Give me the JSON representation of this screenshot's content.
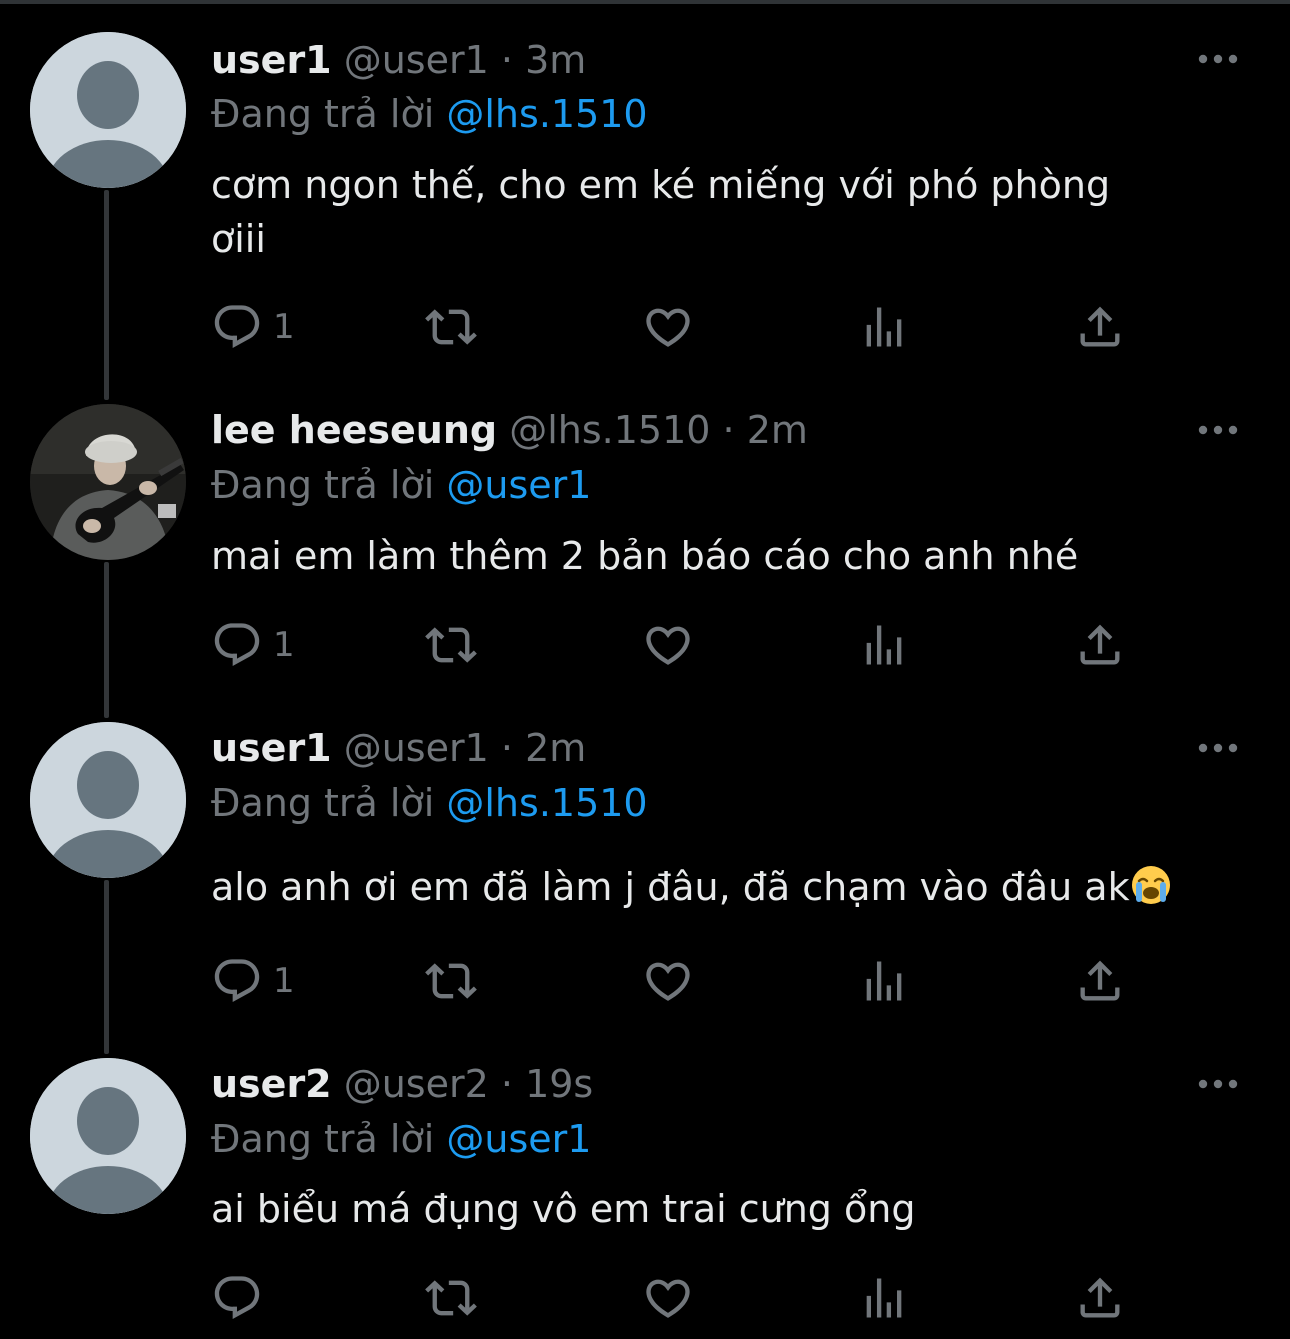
{
  "tweets": [
    {
      "display_name": "user1",
      "handle": "@user1",
      "separator": "·",
      "time": "3m",
      "replying_prefix": "Đang trả lời",
      "replying_to": "@lhs.1510",
      "text_line1": "cơm ngon thế, cho em ké miếng với phó phòng",
      "text_line2": "ơiii",
      "reply_count": "1",
      "avatar_icon": "default-avatar-icon"
    },
    {
      "display_name": "lee heeseung",
      "handle": "@lhs.1510",
      "separator": "·",
      "time": "2m",
      "replying_prefix": "Đang trả lời",
      "replying_to": "@user1",
      "text_line1": "mai em làm thêm 2 bản báo cáo cho anh nhé",
      "reply_count": "1",
      "avatar_icon": "photo-avatar"
    },
    {
      "display_name": "user1",
      "handle": "@user1",
      "separator": "·",
      "time": "2m",
      "replying_prefix": "Đang trả lời",
      "replying_to": "@lhs.1510",
      "text_line1": "alo anh ơi em đã làm j đâu, đã chạm vào đâu ak",
      "reply_count": "1",
      "avatar_icon": "default-avatar-icon"
    },
    {
      "display_name": "user2",
      "handle": "@user2",
      "separator": "·",
      "time": "19s",
      "replying_prefix": "Đang trả lời",
      "replying_to": "@user1",
      "text_line1": "ai biểu má đụng vô em trai cưng ổng",
      "reply_count": "",
      "avatar_icon": "default-avatar-icon"
    }
  ],
  "colors": {
    "background": "#000000",
    "text_primary": "#e7e9ea",
    "text_secondary": "#71767b",
    "mention": "#1d9bf0",
    "thread_line": "#333639"
  },
  "icons": {
    "reply": "reply-icon",
    "retweet": "retweet-icon",
    "like": "heart-icon",
    "views": "views-icon",
    "share": "share-icon",
    "more": "more-icon",
    "emoji": "loudly-crying-face-emoji"
  }
}
